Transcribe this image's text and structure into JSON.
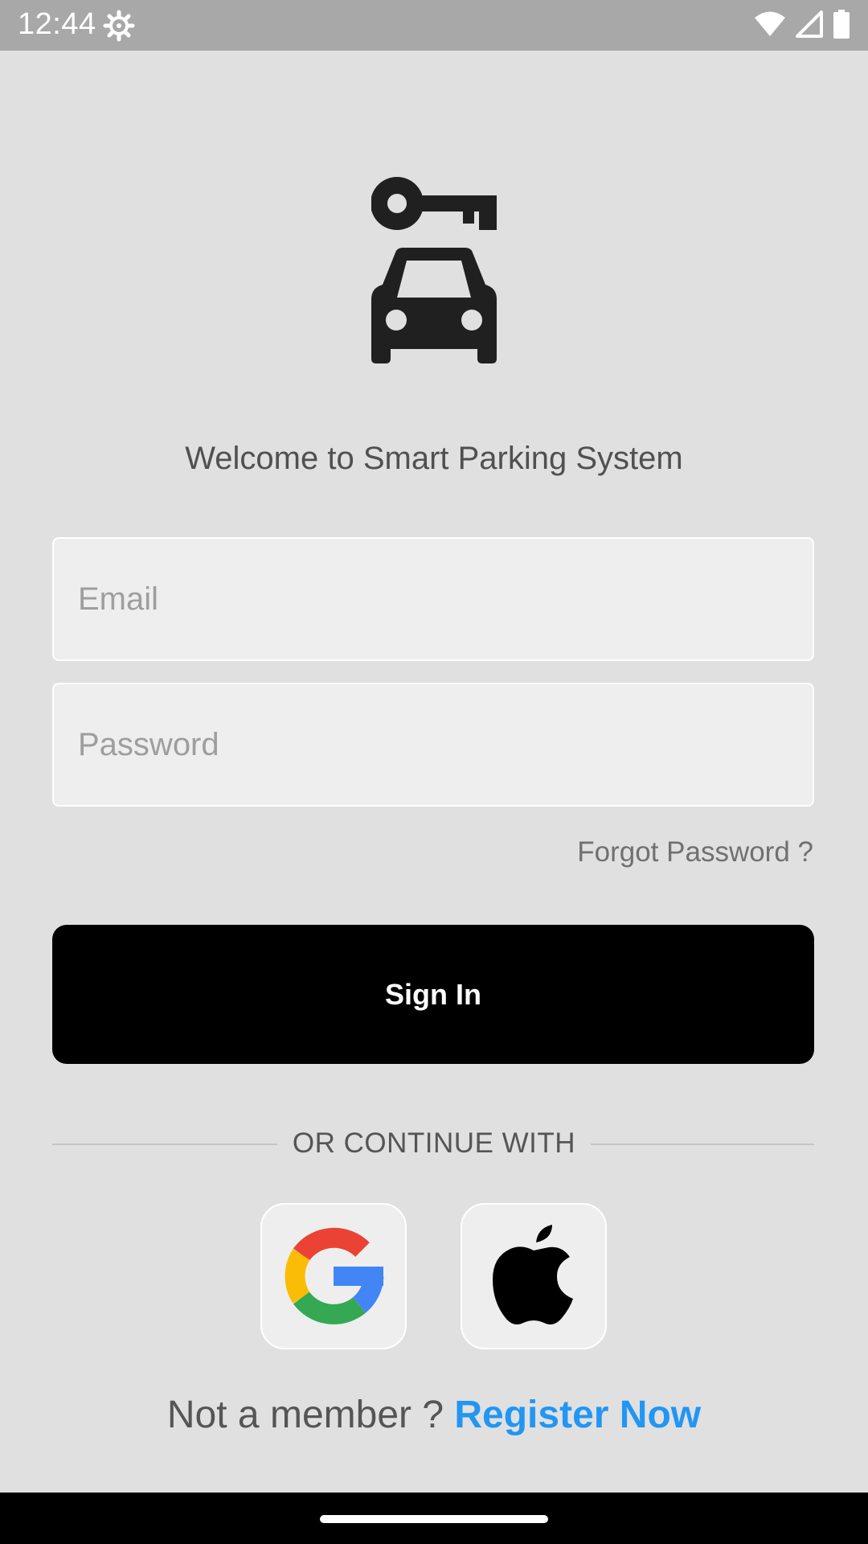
{
  "status_bar": {
    "time": "12:44",
    "icons": [
      "settings-icon",
      "wifi-icon",
      "signal-icon",
      "battery-icon"
    ]
  },
  "logo": {
    "icon": "car-key-icon"
  },
  "welcome_text": "Welcome to Smart Parking System",
  "form": {
    "email_placeholder": "Email",
    "email_value": "",
    "password_placeholder": "Password",
    "password_value": "",
    "forgot_password": "Forgot Password ?",
    "sign_in": "Sign In"
  },
  "divider_text": "OR CONTINUE WITH",
  "social": [
    {
      "name": "Google",
      "icon": "google-icon"
    },
    {
      "name": "Apple",
      "icon": "apple-icon"
    }
  ],
  "register": {
    "prompt": "Not a member ?",
    "link": "Register Now"
  },
  "colors": {
    "background": "#e0e0e0",
    "accent": "#2196f3",
    "button": "#000000",
    "status_bar": "#a8a8a8"
  }
}
